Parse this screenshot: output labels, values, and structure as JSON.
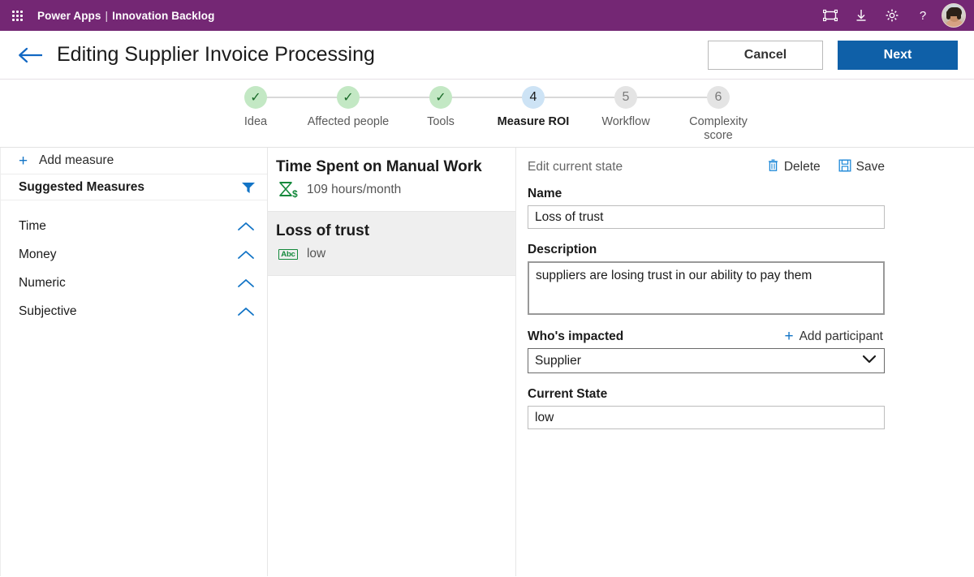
{
  "topbar": {
    "waffle_icon": "app-launcher-icon",
    "brand": "Power Apps",
    "separator": "|",
    "app_name": "Innovation Backlog",
    "icons": [
      {
        "name": "frame-icon",
        "title": "Frame"
      },
      {
        "name": "download-icon",
        "title": "Download"
      },
      {
        "name": "gear-icon",
        "title": "Settings"
      },
      {
        "name": "help-icon",
        "title": "Help"
      }
    ],
    "avatar": "user-avatar"
  },
  "command_bar": {
    "back_icon": "back-arrow-icon",
    "title": "Editing Supplier Invoice Processing",
    "cancel_label": "Cancel",
    "next_label": "Next",
    "next_color": "#0f60a8"
  },
  "stepper": {
    "steps": [
      {
        "number": "1",
        "mark": "✓",
        "label": "Idea",
        "state": "done"
      },
      {
        "number": "2",
        "mark": "✓",
        "label": "Affected people",
        "state": "done"
      },
      {
        "number": "3",
        "mark": "✓",
        "label": "Tools",
        "state": "done"
      },
      {
        "number": "4",
        "mark": "4",
        "label": "Measure ROI",
        "state": "active"
      },
      {
        "number": "5",
        "mark": "5",
        "label": "Workflow",
        "state": "todo"
      },
      {
        "number": "6",
        "mark": "6",
        "label": "Complexity score",
        "state": "todo"
      }
    ],
    "done_color": "#c3e8c4",
    "active_color": "#cde3f5",
    "todo_color": "#e4e4e4"
  },
  "sidebar": {
    "add_measure_label": "Add measure",
    "add_icon": "plus-icon",
    "suggested_title": "Suggested Measures",
    "filter_icon": "filter-icon",
    "categories": [
      {
        "label": "Time",
        "chevron": "chevron-up-icon"
      },
      {
        "label": "Money",
        "chevron": "chevron-up-icon"
      },
      {
        "label": "Numeric",
        "chevron": "chevron-up-icon"
      },
      {
        "label": "Subjective",
        "chevron": "chevron-up-icon"
      }
    ]
  },
  "measures": {
    "items": [
      {
        "title": "Time Spent on Manual Work",
        "value": "109 hours/month",
        "icon": "hourglass-dollar-icon",
        "selected": false
      },
      {
        "title": "Loss of trust",
        "value": "low",
        "icon": "abc-icon",
        "icon_text": "Abc",
        "selected": true
      }
    ],
    "icon_color": "#14893c"
  },
  "details": {
    "header_label": "Edit current state",
    "delete_label": "Delete",
    "delete_icon": "trash-icon",
    "save_label": "Save",
    "save_icon": "save-disk-icon",
    "name_label": "Name",
    "name_value": "Loss of trust",
    "description_label": "Description",
    "description_value": "suppliers are losing trust in our ability to pay them",
    "impacted_label": "Who's impacted",
    "add_participant_label": "Add participant",
    "add_participant_icon": "plus-icon",
    "impacted_value": "Supplier",
    "impacted_chevron": "chevron-down-icon",
    "current_state_label": "Current State",
    "current_state_value": "low"
  }
}
